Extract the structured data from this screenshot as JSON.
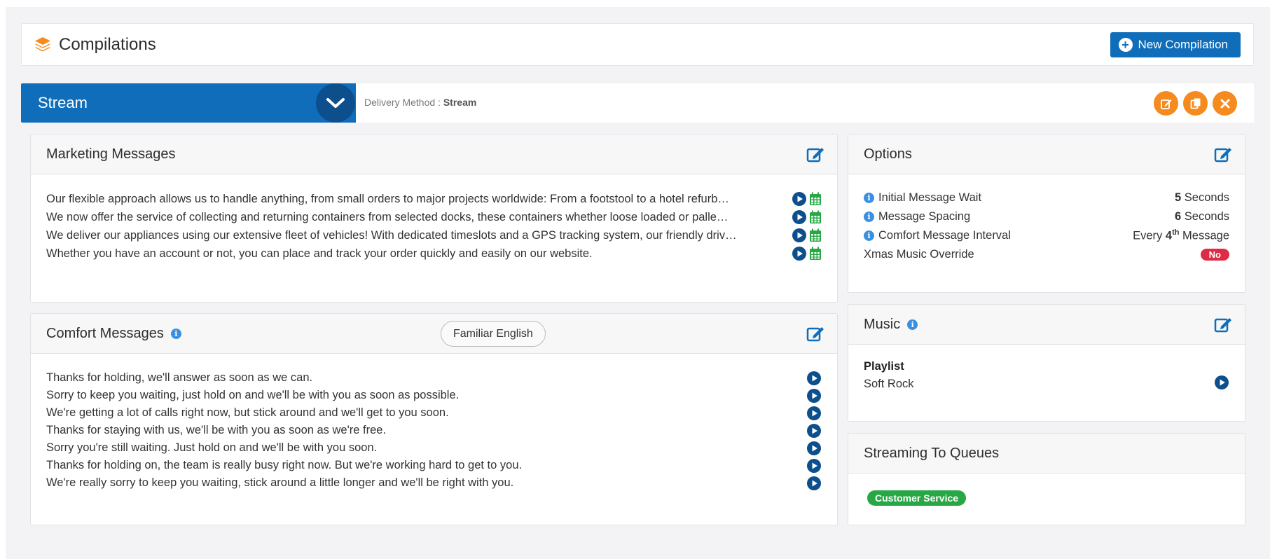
{
  "page": {
    "title": "Compilations",
    "new_button_label": "New Compilation"
  },
  "compilation": {
    "name": "Stream",
    "delivery_label": "Delivery Method :",
    "delivery_value": "Stream"
  },
  "marketing": {
    "title": "Marketing Messages",
    "messages": [
      "Our flexible approach allows us to handle anything, from small orders to major projects worldwide: From a footstool to a hotel refurb…",
      "We now offer the service of collecting and returning containers from selected docks, these containers whether loose loaded or palle…",
      "We deliver our appliances using our extensive fleet of vehicles! With dedicated timeslots and a GPS tracking system, our friendly driv…",
      "Whether you have an account or not, you can place and track your order quickly and easily on our website."
    ]
  },
  "comfort": {
    "title": "Comfort Messages",
    "language": "Familiar English",
    "messages": [
      "Thanks for holding, we'll answer as soon as we can.",
      "Sorry to keep you waiting, just hold on and we'll be with you as soon as possible.",
      "We're getting a lot of calls right now, but stick around and we'll get to you soon.",
      "Thanks for staying with us, we'll be with you as soon as we're free.",
      "Sorry you're still waiting. Just hold on and we'll be with you soon.",
      "Thanks for holding on, the team is really busy right now. But we're working hard to get to you.",
      "We're really sorry to keep you waiting, stick around a little longer and we'll be right with you."
    ]
  },
  "options": {
    "title": "Options",
    "initial_wait_label": "Initial Message Wait",
    "initial_wait_value": "5",
    "initial_wait_unit": "Seconds",
    "spacing_label": "Message Spacing",
    "spacing_value": "6",
    "spacing_unit": "Seconds",
    "comfort_interval_label": "Comfort Message Interval",
    "comfort_interval_prefix": "Every",
    "comfort_interval_value": "4",
    "comfort_interval_suffix": "th",
    "comfort_interval_unit": "Message",
    "xmas_label": "Xmas Music Override",
    "xmas_value": "No"
  },
  "music": {
    "title": "Music",
    "playlist_label": "Playlist",
    "playlist_name": "Soft Rock"
  },
  "queues": {
    "title": "Streaming To Queues",
    "items": [
      "Customer Service"
    ]
  },
  "colors": {
    "primary": "#0f6dba",
    "accent_orange": "#f58a1f",
    "play_blue": "#0d4f8c",
    "calendar_green": "#27a844",
    "badge_red": "#dd2c45"
  }
}
